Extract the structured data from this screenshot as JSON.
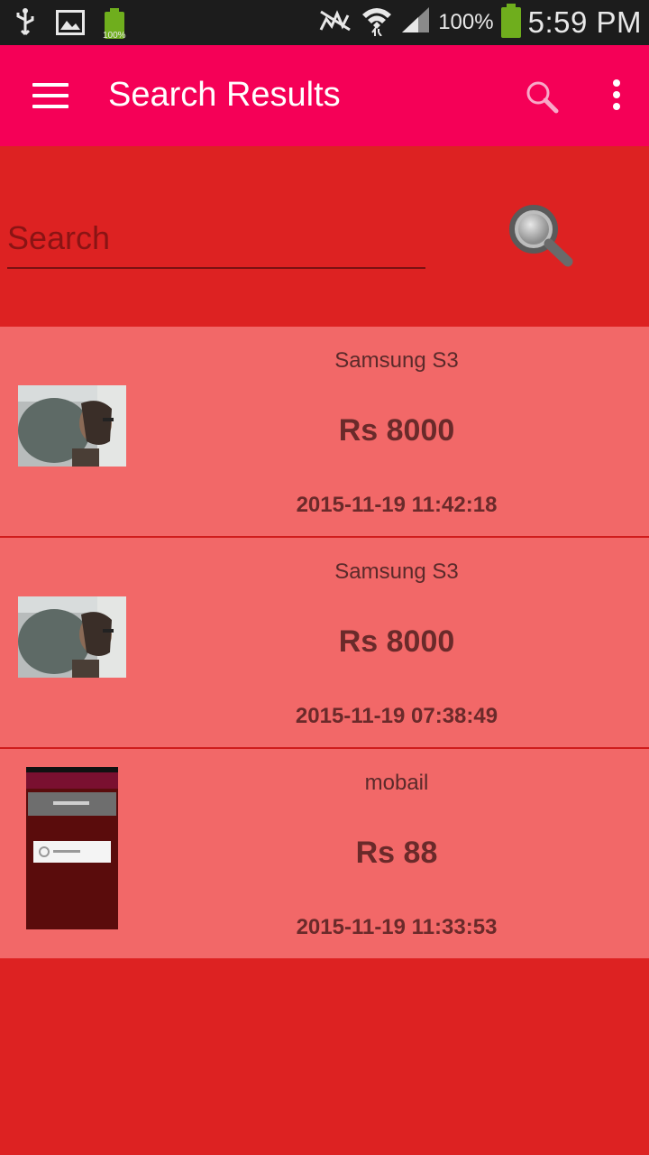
{
  "status_bar": {
    "time": "5:59 PM",
    "battery_percent": "100%",
    "small_battery_percent": "100%",
    "icons": [
      "usb-icon",
      "image-icon",
      "battery-icon",
      "no-signal-icon",
      "wifi-icon",
      "signal-icon",
      "battery-icon"
    ]
  },
  "appbar": {
    "title": "Search Results",
    "color": "#f50057"
  },
  "search": {
    "placeholder": "Search",
    "value": ""
  },
  "results": [
    {
      "name": "Samsung S3",
      "price": "Rs 8000",
      "date": "2015-11-19 11:42:18",
      "thumbnail": "photo"
    },
    {
      "name": "Samsung S3",
      "price": "Rs 8000",
      "date": "2015-11-19 07:38:49",
      "thumbnail": "photo"
    },
    {
      "name": "mobail",
      "price": "Rs 88",
      "date": "2015-11-19 11:33:53",
      "thumbnail": "screenshot"
    }
  ],
  "colors": {
    "background": "#dd2222",
    "row": "#f26868",
    "status_bar": "#1c1c1c"
  }
}
